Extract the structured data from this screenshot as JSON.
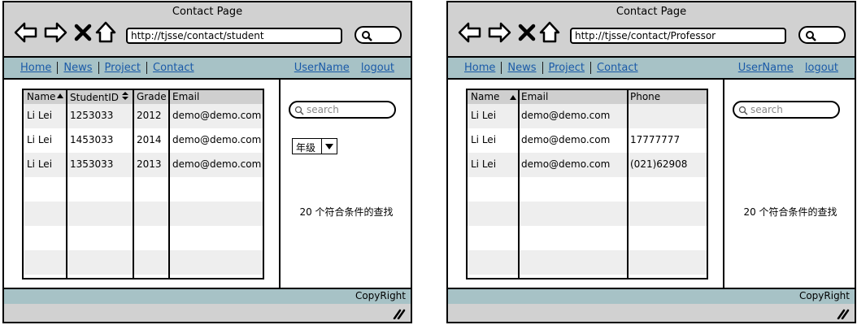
{
  "left": {
    "title": "Contact Page",
    "url": "http://tjsse/contact/student",
    "menu": [
      "Home",
      "News",
      "Project",
      "Contact"
    ],
    "username": "UserName",
    "logout": "logout",
    "table": {
      "headers": [
        "Name",
        "StudentID",
        "Grade",
        "Email"
      ],
      "rows": [
        [
          "Li Lei",
          "1253033",
          "2012",
          "demo@demo.com"
        ],
        [
          "Li Lei",
          "1453033",
          "2014",
          "demo@demo.com"
        ],
        [
          "Li Lei",
          "1353033",
          "2013",
          "demo@demo.com"
        ]
      ]
    },
    "search_placeholder": "search",
    "grade_select": "年级",
    "result_count": "20 个符合条件的查找",
    "footer": "CopyRight"
  },
  "right": {
    "title": "Contact Page",
    "url": "http://tjsse/contact/Professor",
    "menu": [
      "Home",
      "News",
      "Project",
      "Contact"
    ],
    "username": "UserName",
    "logout": "logout",
    "table": {
      "headers": [
        "Name",
        "Email",
        "Phone"
      ],
      "rows": [
        [
          "Li Lei",
          "demo@demo.com",
          ""
        ],
        [
          "Li Lei",
          "demo@demo.com",
          "17777777"
        ],
        [
          "Li Lei",
          "demo@demo.com",
          "(021)62908"
        ]
      ]
    },
    "search_placeholder": "search",
    "result_count": "20 个符合条件的查找",
    "footer": "CopyRight"
  }
}
